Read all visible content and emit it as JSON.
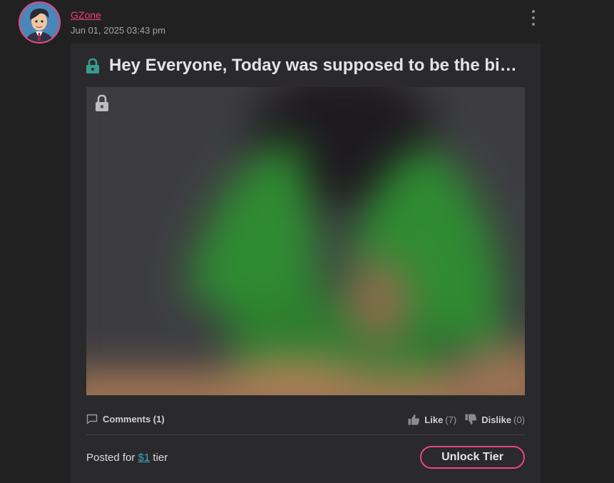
{
  "author": {
    "name": "GZone",
    "date": "Jun 01, 2025 03:43 pm"
  },
  "post": {
    "title": "Hey Everyone, Today was supposed to be the big d…",
    "comments_label": "Comments (1)",
    "like_label": "Like",
    "like_count": "(7)",
    "dislike_label": "Dislike",
    "dislike_count": "(0)",
    "tier_prefix": "Posted for",
    "tier_amount": "$1",
    "tier_suffix": "tier",
    "unlock_label": "Unlock Tier"
  },
  "icons": {
    "title_lock": "lock-icon",
    "media_lock": "lock-icon",
    "comments": "comment-icon",
    "like": "thumbs-up-icon",
    "dislike": "thumbs-down-icon",
    "menu": "kebab-menu-icon"
  },
  "colors": {
    "background": "#212122",
    "card": "#2a2a2c",
    "accent_pink": "#e8487a",
    "author_link": "#ef3f77",
    "lock_teal": "#3a9a8c",
    "tier_link": "#3aa7c4"
  }
}
